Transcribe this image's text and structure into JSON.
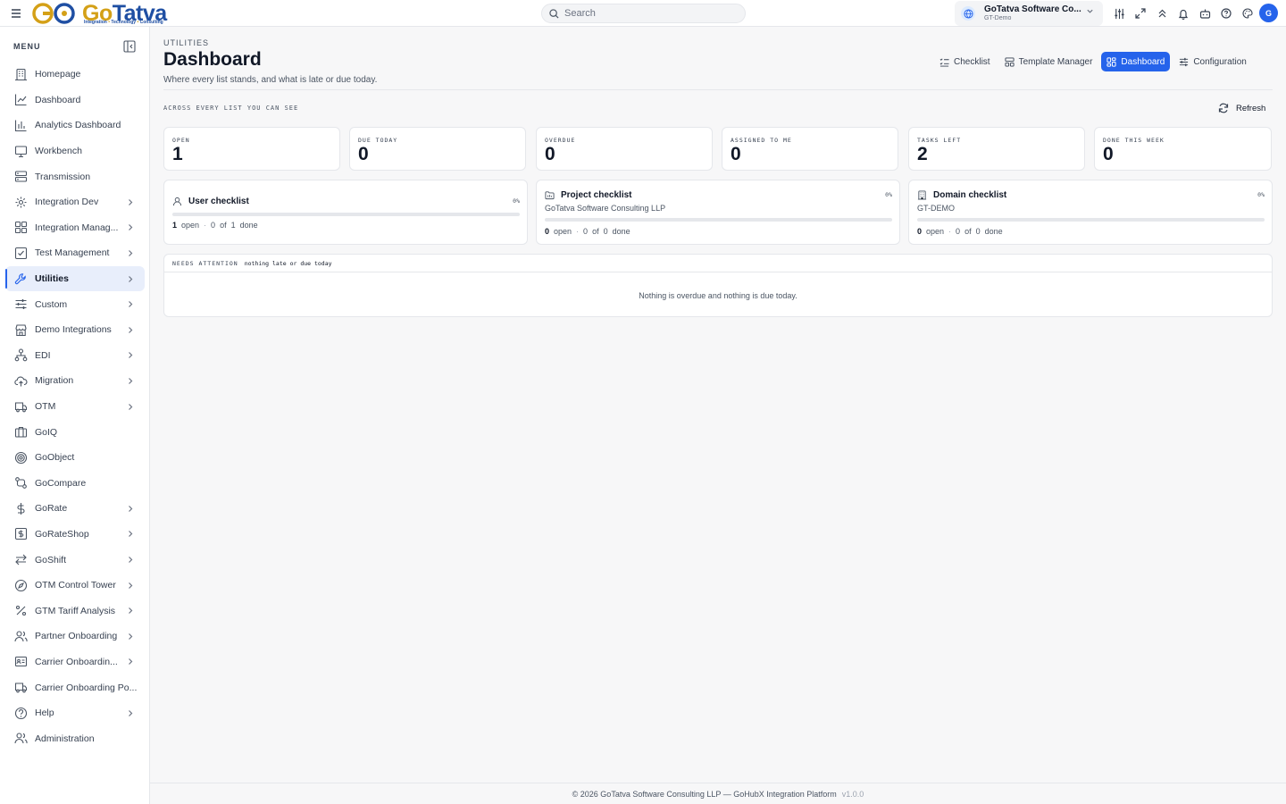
{
  "brand": {
    "logo_main": "Go",
    "logo_ta": "Tatva",
    "logo_tagline_1": "Integration",
    "logo_tagline_2": "Technology",
    "logo_tagline_3": "Consulting"
  },
  "topbar": {
    "search_placeholder": "Search",
    "tenant_name": "GoTatva Software Co...",
    "tenant_sub": "GT-Demo",
    "avatar_letter": "G"
  },
  "sidebar": {
    "menu_label": "MENU",
    "items": [
      {
        "label": "Homepage",
        "icon": "building-icon",
        "chevron": false
      },
      {
        "label": "Dashboard",
        "icon": "line-chart-icon",
        "chevron": false
      },
      {
        "label": "Analytics Dashboard",
        "icon": "bar-chart-icon",
        "chevron": false
      },
      {
        "label": "Workbench",
        "icon": "monitor-icon",
        "chevron": false
      },
      {
        "label": "Transmission",
        "icon": "server-icon",
        "chevron": false
      },
      {
        "label": "Integration Dev",
        "icon": "gear-icon",
        "chevron": true
      },
      {
        "label": "Integration Manag...",
        "icon": "grid-icon",
        "chevron": true
      },
      {
        "label": "Test Management",
        "icon": "check-square-icon",
        "chevron": true
      },
      {
        "label": "Utilities",
        "icon": "wrench-icon",
        "chevron": true,
        "active": true
      },
      {
        "label": "Custom",
        "icon": "sliders-icon",
        "chevron": true
      },
      {
        "label": "Demo Integrations",
        "icon": "store-icon",
        "chevron": true
      },
      {
        "label": "EDI",
        "icon": "network-icon",
        "chevron": true
      },
      {
        "label": "Migration",
        "icon": "cloud-upload-icon",
        "chevron": true
      },
      {
        "label": "OTM",
        "icon": "truck-icon",
        "chevron": true
      },
      {
        "label": "GoIQ",
        "icon": "briefcase-icon",
        "chevron": false
      },
      {
        "label": "GoObject",
        "icon": "target-icon",
        "chevron": false
      },
      {
        "label": "GoCompare",
        "icon": "git-compare-icon",
        "chevron": false
      },
      {
        "label": "GoRate",
        "icon": "dollar-icon",
        "chevron": true
      },
      {
        "label": "GoRateShop",
        "icon": "dollar-square-icon",
        "chevron": true
      },
      {
        "label": "GoShift",
        "icon": "swap-icon",
        "chevron": true
      },
      {
        "label": "OTM Control Tower",
        "icon": "compass-icon",
        "chevron": true
      },
      {
        "label": "GTM Tariff Analysis",
        "icon": "percent-icon",
        "chevron": true
      },
      {
        "label": "Partner Onboarding",
        "icon": "users-icon",
        "chevron": true
      },
      {
        "label": "Carrier Onboardin...",
        "icon": "id-card-icon",
        "chevron": true
      },
      {
        "label": "Carrier Onboarding Po...",
        "icon": "truck-icon",
        "chevron": false
      },
      {
        "label": "Help",
        "icon": "help-circle-icon",
        "chevron": true
      },
      {
        "label": "Administration",
        "icon": "users-icon",
        "chevron": false
      }
    ]
  },
  "page": {
    "breadcrumb": "UTILITIES",
    "title": "Dashboard",
    "subtitle": "Where every list stands, and what is late or due today.",
    "tabs": [
      {
        "label": "Checklist",
        "icon": "list-check-icon",
        "active": false
      },
      {
        "label": "Template Manager",
        "icon": "template-icon",
        "active": false
      },
      {
        "label": "Dashboard",
        "icon": "dashboard-icon",
        "active": true
      },
      {
        "label": "Configuration",
        "icon": "sliders-icon",
        "active": false
      }
    ],
    "section_label": "ACROSS EVERY LIST YOU CAN SEE",
    "refresh_label": "Refresh"
  },
  "stats": [
    {
      "label": "OPEN",
      "value": "1"
    },
    {
      "label": "DUE TODAY",
      "value": "0"
    },
    {
      "label": "OVERDUE",
      "value": "0"
    },
    {
      "label": "ASSIGNED TO ME",
      "value": "0"
    },
    {
      "label": "TASKS LEFT",
      "value": "2"
    },
    {
      "label": "DONE THIS WEEK",
      "value": "0"
    }
  ],
  "lists": [
    {
      "title": "User checklist",
      "subtitle": "",
      "percent": "0%",
      "progress": 0,
      "open": "1",
      "open_label": "open",
      "done": "0",
      "of_label": "of",
      "total": "1",
      "done_label": "done",
      "icon": "user-icon"
    },
    {
      "title": "Project checklist",
      "subtitle": "GoTatva Software Consulting LLP",
      "percent": "0%",
      "progress": 0,
      "open": "0",
      "open_label": "open",
      "done": "0",
      "of_label": "of",
      "total": "0",
      "done_label": "done",
      "icon": "folder-icon"
    },
    {
      "title": "Domain checklist",
      "subtitle": "GT-DEMO",
      "percent": "0%",
      "progress": 0,
      "open": "0",
      "open_label": "open",
      "done": "0",
      "of_label": "of",
      "total": "0",
      "done_label": "done",
      "icon": "building-icon"
    }
  ],
  "attention": {
    "label": "NEEDS ATTENTION",
    "status": "nothing late or due today",
    "message": "Nothing is overdue and nothing is due today."
  },
  "footer": {
    "text": "© 2026 GoTatva Software Consulting LLP — GoHubX Integration Platform",
    "version": "v1.0.0"
  },
  "colors": {
    "accent": "#2563eb",
    "brand_gold": "#d4a017",
    "brand_blue": "#1f4fa3"
  }
}
